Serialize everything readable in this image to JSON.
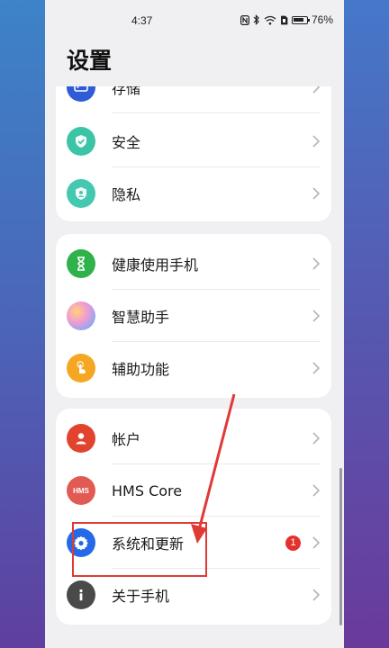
{
  "status_bar": {
    "time": "4:37",
    "battery": "76%"
  },
  "title": "设置",
  "cards": [
    {
      "items": [
        {
          "label": "存储",
          "icon": "storage-icon",
          "color": "#2f5bd7"
        },
        {
          "label": "安全",
          "icon": "shield-icon",
          "color": "#3cc4a6"
        },
        {
          "label": "隐私",
          "icon": "privacy-shield-icon",
          "color": "#45c8b0"
        }
      ]
    },
    {
      "items": [
        {
          "label": "健康使用手机",
          "icon": "hourglass-icon",
          "color": "#2fb24a"
        },
        {
          "label": "智慧助手",
          "icon": "assistant-icon",
          "color": "#e9a1d6"
        },
        {
          "label": "辅助功能",
          "icon": "accessibility-hand-icon",
          "color": "#f5a623"
        }
      ]
    },
    {
      "items": [
        {
          "label": "帐户",
          "icon": "account-icon",
          "color": "#e2432f"
        },
        {
          "label": "HMS Core",
          "icon": "hms-logo-icon",
          "color": "#e25a54"
        },
        {
          "label": "系统和更新",
          "icon": "gear-icon",
          "color": "#2569e8",
          "badge": "1"
        },
        {
          "label": "关于手机",
          "icon": "info-icon",
          "color": "#4a4a4a"
        }
      ]
    }
  ],
  "annotation_color": "#e03a37"
}
